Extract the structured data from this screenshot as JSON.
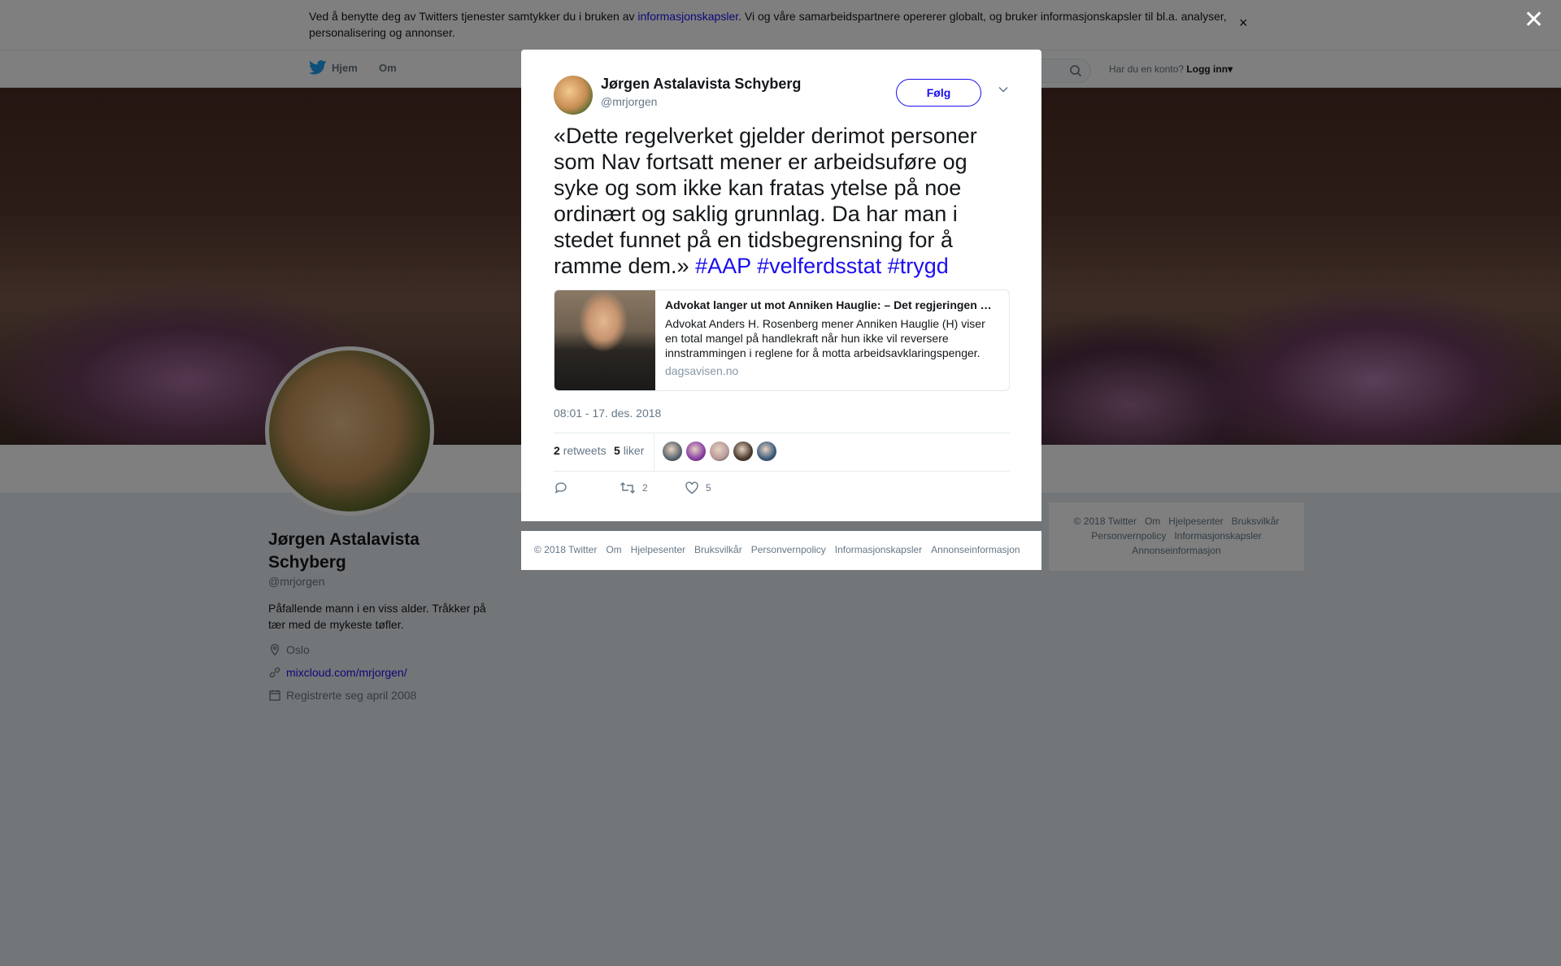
{
  "cookie_banner": {
    "text_before": "Ved å benytte deg av Twitters tjenester samtykker du i bruken av ",
    "link": "informasjonskapsler",
    "text_after": ". Vi og våre samarbeidspartnere opererer globalt, og bruker informasjonskapsler til bl.a. analyser, personalisering og annonser.",
    "close": "×"
  },
  "nav": {
    "home": "Hjem",
    "about": "Om",
    "account_prompt": "Har du en konto?",
    "login": "Logg inn",
    "login_caret": "▾"
  },
  "profile": {
    "name": "Jørgen Astalavista Schyberg",
    "handle": "@mrjorgen",
    "bio": "Påfallende mann i en viss alder. Tråkker på tær med de mykeste tøfler.",
    "location": "Oslo",
    "website": "mixcloud.com/mrjorgen/",
    "joined": "Registrerte seg april 2008"
  },
  "right_footer": {
    "links": [
      "© 2018 Twitter",
      "Om",
      "Hjelpesenter",
      "Bruksvilkår",
      "Personvernpolicy",
      "Informasjonskapsler",
      "Annonseinformasjon"
    ]
  },
  "overlay": {
    "close": "✕"
  },
  "tweet": {
    "author_name": "Jørgen Astalavista Schyberg",
    "author_handle": "@mrjorgen",
    "follow_label": "Følg",
    "text": "«Dette regelverket gjelder derimot personer som Nav fortsatt mener er arbeidsuføre og syke og som ikke kan fratas ytelse på noe ordinært og saklig grunnlag. Da har man i stedet funnet på en tidsbegrensning for å ramme dem.» ",
    "hashtags": [
      "#AAP",
      "#velferdsstat",
      "#trygd"
    ],
    "card": {
      "title": "Advokat langer ut mot Anniken Hauglie: – Det regjeringen h…",
      "description": "Advokat Anders H. Rosenberg mener Anniken Hauglie (H) viser en total mangel på handlekraft når hun ikke vil reversere innstrammingen i reglene for å motta arbeidsavklaringspenger.",
      "domain": "dagsavisen.no"
    },
    "timestamp": "08:01 - 17. des. 2018",
    "retweets_count": "2",
    "retweets_label": "retweets",
    "likes_count": "5",
    "likes_label": "liker",
    "action_retweet_count": "2",
    "action_like_count": "5",
    "liker_colors": [
      "#5b6670",
      "#8a3fa6",
      "#b89a9a",
      "#4a3a2e",
      "#3d5b7c"
    ]
  },
  "modal_footer": {
    "links": [
      "© 2018 Twitter",
      "Om",
      "Hjelpesenter",
      "Bruksvilkår",
      "Personvernpolicy",
      "Informasjonskapsler",
      "Annonseinformasjon"
    ]
  }
}
